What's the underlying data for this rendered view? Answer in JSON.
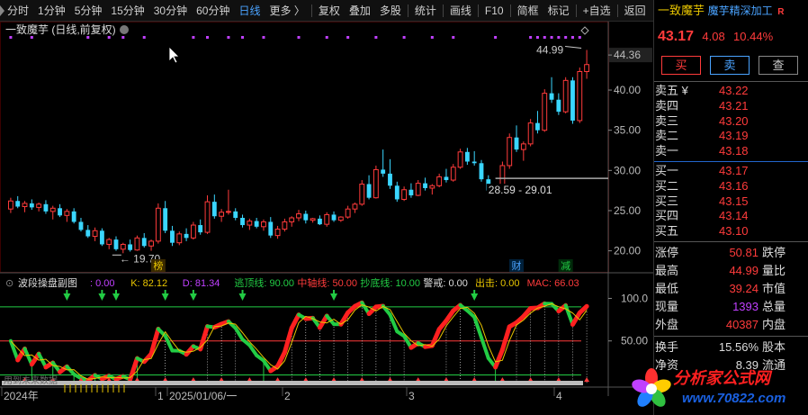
{
  "toolbar": {
    "items": [
      "分时",
      "1分钟",
      "5分钟",
      "15分钟",
      "30分钟",
      "60分钟",
      "日线",
      "更多 〉",
      "复权",
      "叠加",
      "多股",
      "统计",
      "画线",
      "F10",
      "简框",
      "标记",
      "+自选",
      "返回"
    ],
    "active_index": 6
  },
  "main_chart": {
    "title": "一致魔芋 (日线,前复权)",
    "y_ticks": [
      "44.36",
      "40.00",
      "35.00",
      "30.00",
      "25.00",
      "20.00"
    ],
    "high_label": "44.99",
    "low_label": "19.70",
    "range_label": "28.59 - 29.01",
    "markers": {
      "bang": "榜",
      "cai": "财",
      "jian": "减"
    }
  },
  "chart_data": {
    "type": "candlestick",
    "ylim": [
      18.5,
      46.5
    ],
    "candles": [
      [
        25.2,
        26.6,
        24.7,
        26.2
      ],
      [
        26.2,
        26.8,
        25.3,
        25.5
      ],
      [
        25.5,
        26.2,
        24.8,
        25.9
      ],
      [
        25.9,
        26.4,
        25.1,
        25.4
      ],
      [
        25.4,
        26.0,
        24.9,
        25.8
      ],
      [
        25.8,
        26.3,
        24.6,
        24.9
      ],
      [
        24.9,
        25.6,
        23.9,
        25.3
      ],
      [
        25.3,
        25.8,
        24.2,
        24.4
      ],
      [
        24.4,
        25.2,
        23.6,
        24.9
      ],
      [
        24.9,
        25.3,
        23.4,
        23.6
      ],
      [
        23.6,
        24.1,
        22.4,
        22.6
      ],
      [
        22.6,
        23.2,
        21.6,
        21.8
      ],
      [
        21.8,
        22.9,
        21.2,
        22.5
      ],
      [
        22.5,
        22.8,
        20.6,
        20.8
      ],
      [
        20.8,
        21.6,
        20.2,
        21.4
      ],
      [
        21.4,
        21.8,
        20.0,
        20.2
      ],
      [
        20.2,
        21.0,
        19.7,
        20.8
      ],
      [
        20.8,
        21.4,
        19.9,
        20.1
      ],
      [
        20.1,
        21.9,
        20.0,
        21.6
      ],
      [
        21.6,
        22.2,
        20.4,
        20.6
      ],
      [
        20.6,
        21.4,
        20.0,
        21.2
      ],
      [
        21.2,
        25.9,
        20.9,
        25.3
      ],
      [
        25.3,
        26.2,
        22.2,
        22.5
      ],
      [
        22.5,
        23.1,
        20.6,
        21.0
      ],
      [
        21.0,
        22.4,
        20.7,
        22.1
      ],
      [
        22.1,
        22.8,
        21.2,
        21.6
      ],
      [
        21.6,
        23.6,
        21.4,
        23.2
      ],
      [
        23.2,
        23.9,
        22.0,
        22.3
      ],
      [
        22.3,
        26.9,
        22.1,
        26.1
      ],
      [
        26.1,
        27.0,
        24.0,
        24.3
      ],
      [
        24.3,
        25.2,
        23.6,
        24.8
      ],
      [
        24.8,
        27.6,
        24.5,
        24.9
      ],
      [
        24.9,
        25.3,
        23.8,
        24.1
      ],
      [
        24.1,
        24.5,
        22.9,
        23.2
      ],
      [
        23.2,
        24.0,
        22.6,
        23.7
      ],
      [
        23.7,
        24.1,
        22.8,
        23.0
      ],
      [
        23.0,
        23.9,
        22.5,
        23.6
      ],
      [
        23.6,
        24.2,
        21.6,
        21.9
      ],
      [
        21.9,
        23.1,
        21.5,
        22.7
      ],
      [
        22.7,
        24.0,
        22.4,
        23.6
      ],
      [
        23.6,
        24.3,
        23.0,
        24.1
      ],
      [
        24.1,
        25.1,
        23.7,
        24.6
      ],
      [
        24.6,
        25.0,
        23.4,
        23.8
      ],
      [
        23.8,
        24.1,
        23.5,
        24.0
      ],
      [
        24.0,
        24.4,
        23.2,
        23.3
      ],
      [
        23.3,
        24.8,
        23.0,
        24.5
      ],
      [
        24.5,
        24.9,
        23.6,
        23.8
      ],
      [
        23.8,
        24.3,
        23.6,
        24.2
      ],
      [
        24.2,
        25.6,
        24.0,
        25.2
      ],
      [
        25.2,
        26.0,
        24.7,
        25.8
      ],
      [
        25.8,
        28.8,
        25.6,
        28.3
      ],
      [
        28.3,
        29.4,
        26.4,
        26.6
      ],
      [
        26.6,
        30.6,
        26.5,
        30.1
      ],
      [
        30.1,
        32.6,
        29.2,
        29.6
      ],
      [
        29.6,
        31.4,
        27.7,
        28.1
      ],
      [
        28.1,
        28.6,
        26.1,
        26.4
      ],
      [
        26.4,
        28.0,
        26.2,
        27.6
      ],
      [
        27.6,
        28.4,
        26.6,
        26.9
      ],
      [
        26.9,
        28.8,
        26.8,
        28.4
      ],
      [
        28.4,
        29.1,
        27.5,
        27.8
      ],
      [
        27.8,
        28.3,
        27.0,
        28.1
      ],
      [
        28.1,
        29.6,
        27.9,
        29.2
      ],
      [
        29.2,
        30.2,
        28.5,
        28.8
      ],
      [
        28.8,
        30.8,
        28.6,
        30.4
      ],
      [
        30.4,
        32.7,
        30.2,
        32.3
      ],
      [
        32.3,
        32.8,
        30.7,
        31.1
      ],
      [
        31.1,
        32.4,
        30.6,
        30.9
      ],
      [
        30.9,
        31.3,
        28.6,
        28.9
      ],
      [
        28.9,
        29.4,
        27.2,
        27.5
      ],
      [
        27.5,
        28.2,
        26.9,
        27.8
      ],
      [
        27.8,
        31.1,
        27.7,
        30.6
      ],
      [
        30.6,
        34.6,
        30.2,
        34.1
      ],
      [
        34.1,
        35.6,
        32.3,
        32.6
      ],
      [
        32.6,
        33.6,
        31.2,
        33.3
      ],
      [
        33.3,
        36.4,
        33.0,
        35.9
      ],
      [
        35.9,
        37.4,
        34.6,
        35.0
      ],
      [
        35.0,
        40.1,
        34.8,
        39.6
      ],
      [
        39.6,
        41.6,
        38.4,
        38.8
      ],
      [
        38.8,
        39.6,
        36.9,
        37.3
      ],
      [
        37.3,
        41.6,
        37.1,
        41.2
      ],
      [
        41.2,
        41.6,
        35.8,
        36.2
      ],
      [
        36.2,
        42.8,
        35.9,
        42.3
      ],
      [
        42.3,
        44.99,
        41.4,
        43.17
      ]
    ],
    "sub_ylim": [
      0,
      110
    ],
    "sub_ticks": [
      100.0,
      50.0
    ]
  },
  "sub_chart": {
    "name": "波段操盘副图",
    "items": [
      {
        "label": ": 0.00",
        "color": "#c040ff"
      },
      {
        "label": "K: 82.12",
        "color": "#e8c500"
      },
      {
        "label": "D: 81.34",
        "color": "#c040ff"
      },
      {
        "label": "逃顶线: 90.00",
        "color": "#22cc44"
      },
      {
        "label": "中轴线: 50.00",
        "color": "#ff3b3b"
      },
      {
        "label": "抄底线: 10.00",
        "color": "#22cc44"
      },
      {
        "label": "警戒: 0.00",
        "color": "#dddddd"
      },
      {
        "label": "出击: 0.00",
        "color": "#e8c500"
      },
      {
        "label": "MAC: 66.03",
        "color": "#ff3b3b"
      }
    ],
    "y_ticks": [
      "100.0",
      "50.00"
    ],
    "note": "用到未来数据"
  },
  "time_axis": [
    "2024年",
    "1",
    "2025/01/06/一",
    "2",
    "3",
    "4"
  ],
  "quote": {
    "name": "一致魔芋",
    "industry": "魔芋精深加工",
    "r_flag": "R",
    "price": "43.17",
    "change": "4.08",
    "change_pct": "10.44%",
    "buttons": {
      "buy": "买",
      "sell": "卖",
      "look": "查"
    },
    "sell_levels": [
      {
        "label": "卖五 ¥",
        "price": "43.22"
      },
      {
        "label": "卖四",
        "price": "43.21"
      },
      {
        "label": "卖三",
        "price": "43.20"
      },
      {
        "label": "卖二",
        "price": "43.19"
      },
      {
        "label": "卖一",
        "price": "43.18"
      }
    ],
    "buy_levels": [
      {
        "label": "买一",
        "price": "43.17"
      },
      {
        "label": "买二",
        "price": "43.16"
      },
      {
        "label": "买三",
        "price": "43.15"
      },
      {
        "label": "买四",
        "price": "43.14"
      },
      {
        "label": "买五",
        "price": "43.10"
      }
    ],
    "stats": [
      {
        "label": "涨停",
        "value": "50.81",
        "label2": "跌停",
        "color": "red"
      },
      {
        "label": "最高",
        "value": "44.99",
        "label2": "量比",
        "color": "red"
      },
      {
        "label": "最低",
        "value": "39.24",
        "label2": "市值",
        "color": "red"
      },
      {
        "label": "现量",
        "value": "1393",
        "label2": "总量",
        "color": "pur"
      },
      {
        "label": "外盘",
        "value": "40387",
        "label2": "内盘",
        "color": "red"
      }
    ],
    "stats2": [
      {
        "label": "换手",
        "value": "15.56%",
        "label2": "股本"
      },
      {
        "label": "净资",
        "value": "8.39",
        "label2": "流通"
      }
    ]
  },
  "watermark": {
    "title": "分析家公式网",
    "url": "www.70822.com"
  }
}
